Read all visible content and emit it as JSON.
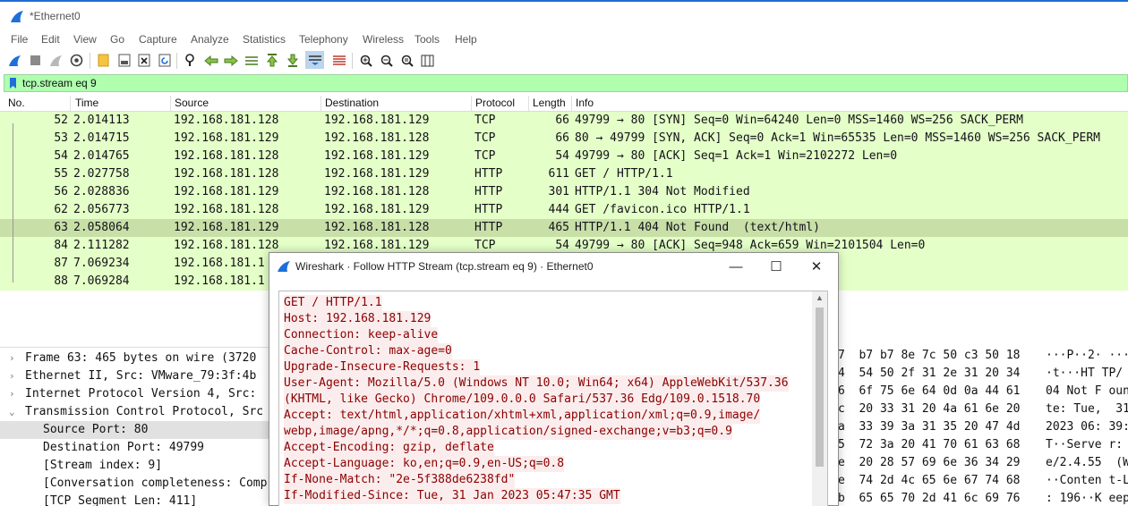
{
  "window": {
    "title": "*Ethernet0"
  },
  "menu": [
    "File",
    "Edit",
    "View",
    "Go",
    "Capture",
    "Analyze",
    "Statistics",
    "Telephony",
    "Wireless",
    "Tools",
    "Help"
  ],
  "toolbar": {
    "icons": [
      "start-capture-icon",
      "stop-capture-icon",
      "restart-capture-icon",
      "capture-options-icon",
      "open-file-icon",
      "save-file-icon",
      "close-file-icon",
      "reload-file-icon",
      "find-packet-icon",
      "go-back-icon",
      "go-forward-icon",
      "go-to-packet-icon",
      "go-first-icon",
      "go-last-icon",
      "autoscroll-icon",
      "colorize-icon",
      "zoom-in-icon",
      "zoom-out-icon",
      "normal-size-icon",
      "resize-columns-icon"
    ]
  },
  "filter": {
    "value": "tcp.stream eq 9"
  },
  "packet_list": {
    "columns": [
      "No.",
      "Time",
      "Source",
      "Destination",
      "Protocol",
      "Length",
      "Info"
    ],
    "rows": [
      {
        "no": "52",
        "time": "2.014113",
        "src": "192.168.181.128",
        "dst": "192.168.181.129",
        "proto": "TCP",
        "len": "66",
        "info": "49799 → 80 [SYN] Seq=0 Win=64240 Len=0 MSS=1460 WS=256 SACK_PERM"
      },
      {
        "no": "53",
        "time": "2.014715",
        "src": "192.168.181.129",
        "dst": "192.168.181.128",
        "proto": "TCP",
        "len": "66",
        "info": "80 → 49799 [SYN, ACK] Seq=0 Ack=1 Win=65535 Len=0 MSS=1460 WS=256 SACK_PERM"
      },
      {
        "no": "54",
        "time": "2.014765",
        "src": "192.168.181.128",
        "dst": "192.168.181.129",
        "proto": "TCP",
        "len": "54",
        "info": "49799 → 80 [ACK] Seq=1 Ack=1 Win=2102272 Len=0"
      },
      {
        "no": "55",
        "time": "2.027758",
        "src": "192.168.181.128",
        "dst": "192.168.181.129",
        "proto": "HTTP",
        "len": "611",
        "info": "GET / HTTP/1.1"
      },
      {
        "no": "56",
        "time": "2.028836",
        "src": "192.168.181.129",
        "dst": "192.168.181.128",
        "proto": "HTTP",
        "len": "301",
        "info": "HTTP/1.1 304 Not Modified"
      },
      {
        "no": "62",
        "time": "2.056773",
        "src": "192.168.181.128",
        "dst": "192.168.181.129",
        "proto": "HTTP",
        "len": "444",
        "info": "GET /favicon.ico HTTP/1.1"
      },
      {
        "no": "63",
        "time": "2.058064",
        "src": "192.168.181.129",
        "dst": "192.168.181.128",
        "proto": "HTTP",
        "len": "465",
        "info": "HTTP/1.1 404 Not Found  (text/html)"
      },
      {
        "no": "84",
        "time": "2.111282",
        "src": "192.168.181.128",
        "dst": "192.168.181.129",
        "proto": "TCP",
        "len": "54",
        "info": "49799 → 80 [ACK] Seq=948 Ack=659 Win=2101504 Len=0"
      },
      {
        "no": "87",
        "time": "7.069234",
        "src": "192.168.181.1",
        "dst": "",
        "proto": "",
        "len": "",
        "info": "3 Win=2101760 Len=0"
      },
      {
        "no": "88",
        "time": "7.069284",
        "src": "192.168.181.1",
        "dst": "",
        "proto": "",
        "len": "",
        "info": "=2101504 Len=0"
      }
    ]
  },
  "details": [
    {
      "expand": "›",
      "text": "Frame 63: 465 bytes on wire (3720"
    },
    {
      "expand": "›",
      "text": "Ethernet II, Src: VMware_79:3f:4b"
    },
    {
      "expand": "›",
      "text": "Internet Protocol Version 4, Src:"
    },
    {
      "expand": "⌄",
      "text": "Transmission Control Protocol, Src"
    },
    {
      "expand": "",
      "text": "Source Port: 80"
    },
    {
      "expand": "",
      "text": "Destination Port: 49799"
    },
    {
      "expand": "",
      "text": "[Stream index: 9]"
    },
    {
      "expand": "",
      "text": "[Conversation completeness: Comp"
    },
    {
      "expand": "",
      "text": "[TCP Segment Len: 411]"
    }
  ],
  "bytes": [
    {
      "hex": "7  b7 b7 8e 7c 50 c3 50 18",
      "ascii": "···P··2· ···"
    },
    {
      "hex": "4  54 50 2f 31 2e 31 20 34",
      "ascii": "·t···HT TP/"
    },
    {
      "hex": "6  6f 75 6e 64 0d 0a 44 61",
      "ascii": "04 Not F oun"
    },
    {
      "hex": "c  20 33 31 20 4a 61 6e 20",
      "ascii": "te: Tue,  31"
    },
    {
      "hex": "a  33 39 3a 31 35 20 47 4d",
      "ascii": "2023 06: 39:"
    },
    {
      "hex": "5  72 3a 20 41 70 61 63 68",
      "ascii": "T··Serve r:"
    },
    {
      "hex": "e  20 28 57 69 6e 36 34 29",
      "ascii": "e/2.4.55  (W"
    },
    {
      "hex": "e  74 2d 4c 65 6e 67 74 68",
      "ascii": "··Conten t-L"
    },
    {
      "hex": "b  65 65 70 2d 41 6c 69 76",
      "ascii": ": 196··K eep"
    },
    {
      "hex": "f  75 74 3d 35 2c 20 6d 61",
      "ascii": "e: timeo ut="
    }
  ],
  "dialog": {
    "title": "Wireshark · Follow HTTP Stream (tcp.stream eq 9) · Ethernet0",
    "minimize": "—",
    "maximize": "☐",
    "close": "✕",
    "lines": [
      "GET / HTTP/1.1",
      "Host: 192.168.181.129",
      "Connection: keep-alive",
      "Cache-Control: max-age=0",
      "Upgrade-Insecure-Requests: 1",
      "User-Agent: Mozilla/5.0 (Windows NT 10.0; Win64; x64) AppleWebKit/537.36",
      "(KHTML, like Gecko) Chrome/109.0.0.0 Safari/537.36 Edg/109.0.1518.70",
      "Accept: text/html,application/xhtml+xml,application/xml;q=0.9,image/",
      "webp,image/apng,*/*;q=0.8,application/signed-exchange;v=b3;q=0.9",
      "Accept-Encoding: gzip, deflate",
      "Accept-Language: ko,en;q=0.9,en-US;q=0.8",
      "If-None-Match: \"2e-5f388de6238fd\"",
      "If-Modified-Since: Tue, 31 Jan 2023 05:47:35 GMT"
    ]
  },
  "colors": {
    "row": "#e4ffc7",
    "row_selected": "#c8dfa8",
    "filter_ok": "#afffaf",
    "request_text": "#8b0000",
    "request_bg": "#fbeded",
    "fin": "#1e6fd9"
  }
}
